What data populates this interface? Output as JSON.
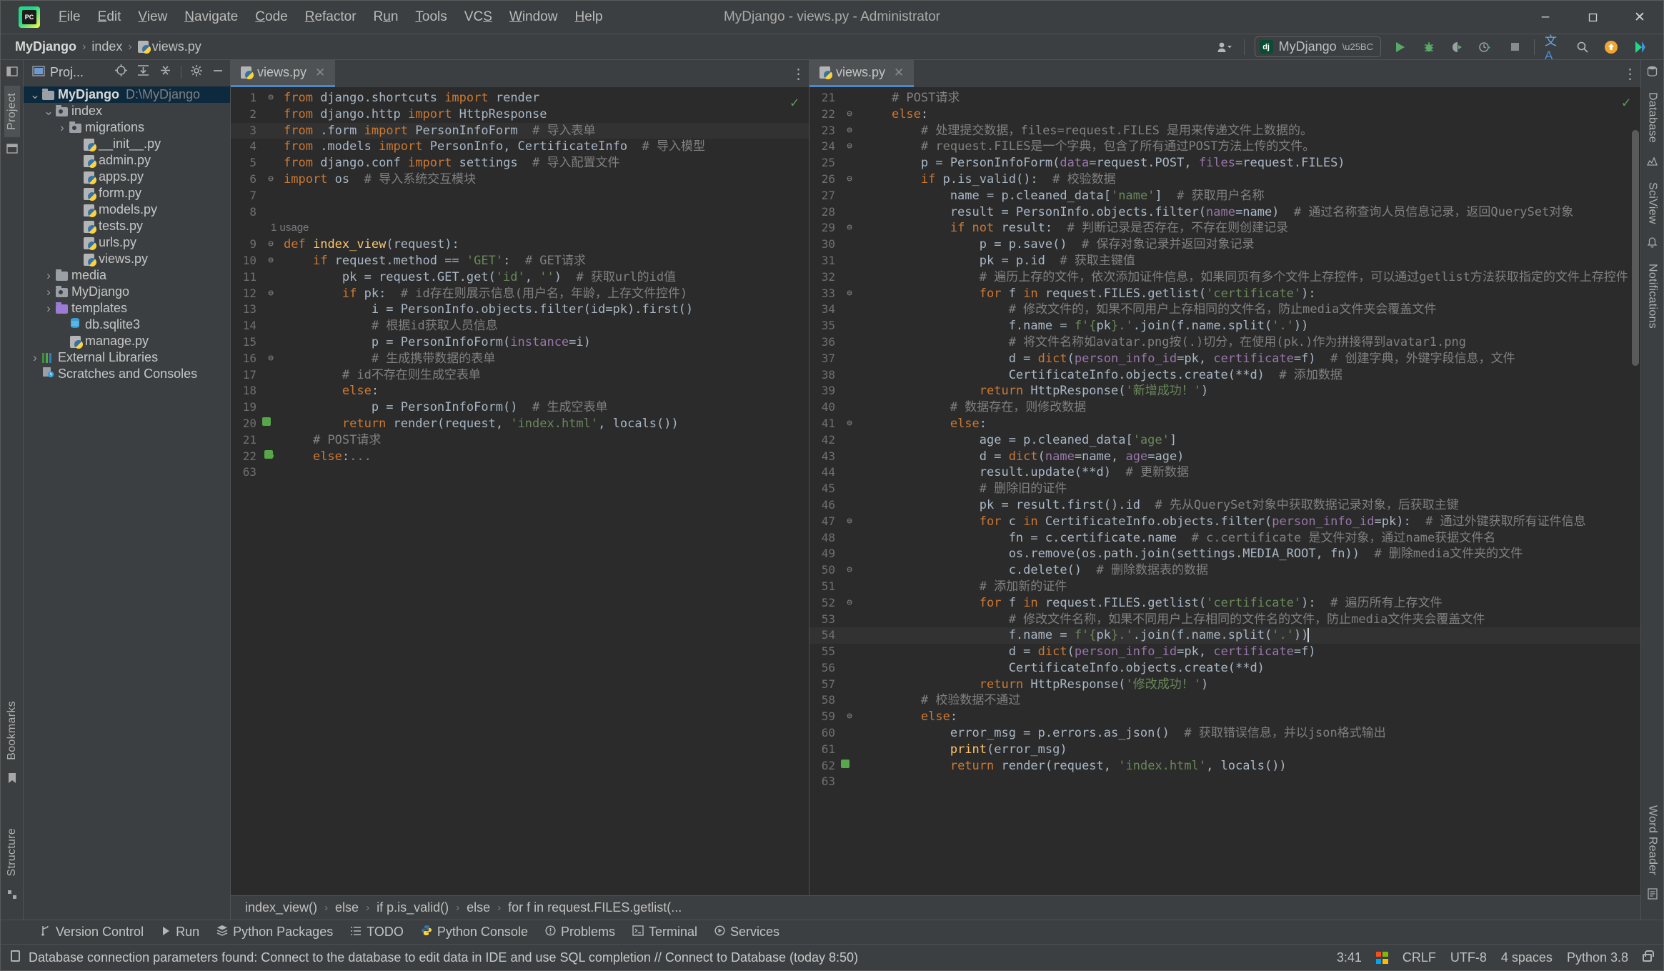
{
  "window": {
    "title": "MyDjango - views.py - Administrator",
    "app_icon": "pycharm-logo-icon",
    "controls": {
      "minimize": "–",
      "maximize": "☐",
      "close": "✕"
    }
  },
  "menubar": [
    {
      "label": "File",
      "mnemonic": "F"
    },
    {
      "label": "Edit",
      "mnemonic": "E"
    },
    {
      "label": "View",
      "mnemonic": "V"
    },
    {
      "label": "Navigate",
      "mnemonic": "N"
    },
    {
      "label": "Code",
      "mnemonic": "C"
    },
    {
      "label": "Refactor",
      "mnemonic": "R"
    },
    {
      "label": "Run",
      "mnemonic": "u"
    },
    {
      "label": "Tools",
      "mnemonic": "T"
    },
    {
      "label": "VCS",
      "mnemonic": "S"
    },
    {
      "label": "Window",
      "mnemonic": "W"
    },
    {
      "label": "Help",
      "mnemonic": "H"
    }
  ],
  "breadcrumb": {
    "project": "MyDjango",
    "folder": "index",
    "file": "views.py",
    "sep": "›"
  },
  "toolbar": {
    "run_config": "MyDjango",
    "run_config_badge": "dj",
    "icons": [
      {
        "name": "profile-icon",
        "glyph": "👤"
      },
      {
        "name": "run-icon",
        "glyph": "▶"
      },
      {
        "name": "debug-icon",
        "glyph": "🐞"
      },
      {
        "name": "run-coverage-icon",
        "glyph": "◐"
      },
      {
        "name": "profiler-icon",
        "glyph": "◴"
      },
      {
        "name": "stop-icon",
        "glyph": "■"
      },
      {
        "name": "translate-icon",
        "glyph": "文A"
      },
      {
        "name": "search-everywhere-icon",
        "glyph": "🔍"
      },
      {
        "name": "update-icon",
        "glyph": "↑"
      },
      {
        "name": "ide-feature-icon",
        "glyph": "◗"
      }
    ]
  },
  "left_strip": {
    "tabs": [
      {
        "label": "Project",
        "name": "tool-tab-project",
        "selected": true
      }
    ],
    "bottom_tabs": [
      {
        "label": "Bookmarks",
        "name": "tool-tab-bookmarks"
      },
      {
        "label": "Structure",
        "name": "tool-tab-structure"
      }
    ]
  },
  "right_strip": {
    "tabs": [
      {
        "label": "Database",
        "name": "tool-tab-database"
      },
      {
        "label": "SciView",
        "name": "tool-tab-sciview"
      },
      {
        "label": "Notifications",
        "name": "tool-tab-notifications"
      },
      {
        "label": "Word Reader",
        "name": "tool-tab-word-reader"
      }
    ]
  },
  "project_panel": {
    "title": "Proj...",
    "header_icons": [
      "locate-icon",
      "expand-all-icon",
      "collapse-all-icon",
      "settings-gear-icon",
      "hide-icon"
    ],
    "tree": [
      {
        "depth": 0,
        "arrow": "down",
        "icon": "folder",
        "label": "MyDjango",
        "path": "D:\\MyDjango",
        "bold": true,
        "selected": true
      },
      {
        "depth": 1,
        "arrow": "down",
        "icon": "folder-package",
        "label": "index"
      },
      {
        "depth": 2,
        "arrow": "right",
        "icon": "folder-package",
        "label": "migrations"
      },
      {
        "depth": 3,
        "arrow": "none",
        "icon": "python-file",
        "label": "__init__.py"
      },
      {
        "depth": 3,
        "arrow": "none",
        "icon": "python-file",
        "label": "admin.py"
      },
      {
        "depth": 3,
        "arrow": "none",
        "icon": "python-file",
        "label": "apps.py"
      },
      {
        "depth": 3,
        "arrow": "none",
        "icon": "python-file",
        "label": "form.py"
      },
      {
        "depth": 3,
        "arrow": "none",
        "icon": "python-file",
        "label": "models.py"
      },
      {
        "depth": 3,
        "arrow": "none",
        "icon": "python-file",
        "label": "tests.py"
      },
      {
        "depth": 3,
        "arrow": "none",
        "icon": "python-file",
        "label": "urls.py"
      },
      {
        "depth": 3,
        "arrow": "none",
        "icon": "python-file",
        "label": "views.py"
      },
      {
        "depth": 1,
        "arrow": "right",
        "icon": "folder",
        "label": "media"
      },
      {
        "depth": 1,
        "arrow": "right",
        "icon": "folder-package",
        "label": "MyDjango"
      },
      {
        "depth": 1,
        "arrow": "right",
        "icon": "folder-purple",
        "label": "templates"
      },
      {
        "depth": 2,
        "arrow": "none",
        "icon": "db-file",
        "label": "db.sqlite3"
      },
      {
        "depth": 2,
        "arrow": "none",
        "icon": "python-file",
        "label": "manage.py"
      },
      {
        "depth": 0,
        "arrow": "right",
        "icon": "library",
        "label": "External Libraries"
      },
      {
        "depth": 0,
        "arrow": "none",
        "icon": "scratches",
        "label": "Scratches and Consoles"
      }
    ]
  },
  "editor_left": {
    "tab": {
      "label": "views.py",
      "icon": "python-file",
      "close": "✕",
      "active": true
    },
    "inspection_ok": "✓",
    "lines": [
      {
        "n": "1",
        "fold": "⊖",
        "html": "<span class=\"kw\">from</span> django.shortcuts <span class=\"kw\">import</span> render"
      },
      {
        "n": "2",
        "fold": "",
        "html": "<span class=\"kw\">from</span> django.http <span class=\"kw\">import</span> HttpResponse"
      },
      {
        "n": "3",
        "fold": "",
        "hl": true,
        "html": "<span class=\"kw\">from</span> .form <span class=\"kw\">import</span> PersonInfoForm  <span class=\"cmt\"># 导入表单</span>"
      },
      {
        "n": "4",
        "fold": "",
        "html": "<span class=\"kw\">from</span> .models <span class=\"kw\">import</span> PersonInfo, CertificateInfo  <span class=\"cmt\"># 导入模型</span>"
      },
      {
        "n": "5",
        "fold": "",
        "html": "<span class=\"kw\">from</span> django.conf <span class=\"kw\">import</span> settings  <span class=\"cmt\"># 导入配置文件</span>"
      },
      {
        "n": "6",
        "fold": "⊖",
        "html": "<span class=\"kw\">import</span> os  <span class=\"cmt\"># 导入系统交互模块</span>"
      },
      {
        "n": "7",
        "fold": "",
        "html": ""
      },
      {
        "n": "8",
        "fold": "",
        "html": ""
      },
      {
        "n": "",
        "fold": "",
        "hint": "1 usage"
      },
      {
        "n": "9",
        "fold": "⊖",
        "html": "<span class=\"kw\">def</span> <span class=\"fn\">index_view</span>(request):"
      },
      {
        "n": "10",
        "fold": "⊖",
        "html": "    <span class=\"kw\">if</span> request.method == <span class=\"str\">'GET'</span>:  <span class=\"cmt\"># GET请求</span>"
      },
      {
        "n": "11",
        "fold": "",
        "html": "        pk = request.GET.get(<span class=\"str\">'id'</span>, <span class=\"str\">''</span>)  <span class=\"cmt\"># 获取url的id值</span>"
      },
      {
        "n": "12",
        "fold": "⊖",
        "html": "        <span class=\"kw\">if</span> pk:  <span class=\"cmt\"># id存在则展示信息(用户名，年龄，上存文件控件)</span>"
      },
      {
        "n": "13",
        "fold": "",
        "html": "            i = PersonInfo.objects.filter(id=pk).first()"
      },
      {
        "n": "14",
        "fold": "",
        "html": "            <span class=\"cmt\"># 根据id获取人员信息</span>"
      },
      {
        "n": "15",
        "fold": "",
        "html": "            p = PersonInfoForm(<span class=\"par\">instance</span>=i)"
      },
      {
        "n": "16",
        "fold": "⊖",
        "html": "            <span class=\"cmt\"># 生成携带数据的表单</span>"
      },
      {
        "n": "17",
        "fold": "",
        "html": "        <span class=\"cmt\"># id不存在则生成空表单</span>"
      },
      {
        "n": "18",
        "fold": "",
        "html": "        <span class=\"kw\">else</span>:"
      },
      {
        "n": "19",
        "fold": "",
        "html": "            p = PersonInfoForm()  <span class=\"cmt\"># 生成空表单</span>"
      },
      {
        "n": "20",
        "fold": "",
        "mark": true,
        "html": "        <span class=\"kw\">return</span> render(request, <span class=\"str\">'index.html'</span>, locals())"
      },
      {
        "n": "21",
        "fold": "",
        "html": "    <span class=\"cmt\"># POST请求</span>"
      },
      {
        "n": "22",
        "fold": "⊖",
        "mark": true,
        "html": "    <span class=\"kw\">else</span>:<span class=\"cmt\">...</span>"
      },
      {
        "n": "63",
        "fold": "",
        "html": ""
      }
    ]
  },
  "editor_right": {
    "tab": {
      "label": "views.py",
      "icon": "python-file",
      "close": "✕",
      "active": true
    },
    "inspection_ok": "✓",
    "lines": [
      {
        "n": "21",
        "fold": "",
        "html": "    <span class=\"cmt\"># POST请求</span>"
      },
      {
        "n": "22",
        "fold": "⊖",
        "html": "    <span class=\"kw\">else</span>:"
      },
      {
        "n": "23",
        "fold": "⊖",
        "html": "        <span class=\"cmt\"># 处理提交数据，files=request.FILES 是用来传递文件上数据的。</span>"
      },
      {
        "n": "24",
        "fold": "⊖",
        "html": "        <span class=\"cmt\"># request.FILES是一个字典，包含了所有通过POST方法上传的文件。</span>"
      },
      {
        "n": "25",
        "fold": "",
        "html": "        p = PersonInfoForm(<span class=\"par\">data</span>=request.POST, <span class=\"par\">files</span>=request.FILES)"
      },
      {
        "n": "26",
        "fold": "⊖",
        "html": "        <span class=\"kw\">if</span> p.is_valid():  <span class=\"cmt\"># 校验数据</span>"
      },
      {
        "n": "27",
        "fold": "",
        "html": "            name = p.cleaned_data[<span class=\"str\">'name'</span>]  <span class=\"cmt\"># 获取用户名称</span>"
      },
      {
        "n": "28",
        "fold": "",
        "html": "            result = PersonInfo.objects.filter(<span class=\"par\">name</span>=name)  <span class=\"cmt\"># 通过名称查询人员信息记录，返回QuerySet对象</span>"
      },
      {
        "n": "29",
        "fold": "⊖",
        "html": "            <span class=\"kw\">if not</span> result:  <span class=\"cmt\"># 判断记录是否存在，不存在则创建记录</span>"
      },
      {
        "n": "30",
        "fold": "",
        "html": "                p = p.save()  <span class=\"cmt\"># 保存对象记录并返回对象记录</span>"
      },
      {
        "n": "31",
        "fold": "",
        "html": "                pk = p.id  <span class=\"cmt\"># 获取主键值</span>"
      },
      {
        "n": "32",
        "fold": "",
        "html": "                <span class=\"cmt\"># 遍历上存的文件，依次添加证件信息，如果同页有多个文件上存控件，可以通过getlist方法获取指定的文件上存控件</span>"
      },
      {
        "n": "33",
        "fold": "⊖",
        "html": "                <span class=\"kw\">for</span> f <span class=\"kw\">in</span> request.FILES.getlist(<span class=\"str\">'certificate'</span>):"
      },
      {
        "n": "34",
        "fold": "",
        "html": "                    <span class=\"cmt\"># 修改文件的，如果不同用户上存相同的文件名，防止media文件夹会覆盖文件</span>"
      },
      {
        "n": "35",
        "fold": "",
        "html": "                    f.name = <span class=\"str\">f'{</span>pk<span class=\"str\">}.'</span>.join(f.name.split(<span class=\"str\">'.'</span>))"
      },
      {
        "n": "36",
        "fold": "",
        "html": "                    <span class=\"cmt\"># 将文件名称如avatar.png按(.)切分，在使用(pk.)作为拼接得到avatar1.png</span>"
      },
      {
        "n": "37",
        "fold": "",
        "html": "                    d = <span class=\"kw2\">dict</span>(<span class=\"par\">person_info_id</span>=pk, <span class=\"par\">certificate</span>=f)  <span class=\"cmt\"># 创建字典，外键字段信息，文件</span>"
      },
      {
        "n": "38",
        "fold": "",
        "html": "                    CertificateInfo.objects.create(**d)  <span class=\"cmt\"># 添加数据</span>"
      },
      {
        "n": "39",
        "fold": "",
        "html": "                <span class=\"kw\">return</span> HttpResponse(<span class=\"str\">'新增成功！'</span>)"
      },
      {
        "n": "40",
        "fold": "",
        "html": "            <span class=\"cmt\"># 数据存在，则修改数据</span>"
      },
      {
        "n": "41",
        "fold": "⊖",
        "html": "            <span class=\"kw\">else</span>:"
      },
      {
        "n": "42",
        "fold": "",
        "html": "                age = p.cleaned_data[<span class=\"str\">'age'</span>]"
      },
      {
        "n": "43",
        "fold": "",
        "html": "                d = <span class=\"kw2\">dict</span>(<span class=\"par\">name</span>=name, <span class=\"par\">age</span>=age)"
      },
      {
        "n": "44",
        "fold": "",
        "html": "                result.update(**d)  <span class=\"cmt\"># 更新数据</span>"
      },
      {
        "n": "45",
        "fold": "",
        "html": "                <span class=\"cmt\"># 删除旧的证件</span>"
      },
      {
        "n": "46",
        "fold": "",
        "html": "                pk = result.first().id  <span class=\"cmt\"># 先从QuerySet对象中获取数据记录对象，后获取主键</span>"
      },
      {
        "n": "47",
        "fold": "⊖",
        "html": "                <span class=\"kw\">for</span> c <span class=\"kw\">in</span> CertificateInfo.objects.filter(<span class=\"par\">person_info_id</span>=pk):  <span class=\"cmt\"># 通过外键获取所有证件信息</span>"
      },
      {
        "n": "48",
        "fold": "",
        "html": "                    fn = c.certificate.name  <span class=\"cmt\"># c.certificate 是文件对象，通过name获据文件名</span>"
      },
      {
        "n": "49",
        "fold": "",
        "html": "                    os.remove(os.path.join(settings.MEDIA_ROOT, fn))  <span class=\"cmt\"># 删除media文件夹的文件</span>"
      },
      {
        "n": "50",
        "fold": "⊖",
        "html": "                    c.delete()  <span class=\"cmt\"># 删除数据表的数据</span>"
      },
      {
        "n": "51",
        "fold": "",
        "html": "                <span class=\"cmt\"># 添加新的证件</span>"
      },
      {
        "n": "52",
        "fold": "⊖",
        "html": "                <span class=\"kw\">for</span> f <span class=\"kw\">in</span> request.FILES.getlist(<span class=\"str\">'certificate'</span>):  <span class=\"cmt\"># 遍历所有上存文件</span>"
      },
      {
        "n": "53",
        "fold": "",
        "html": "                    <span class=\"cmt\"># 修改文件名称，如果不同用户上存相同的文件名的文件，防止media文件夹会覆盖文件</span>"
      },
      {
        "n": "54",
        "fold": "",
        "hl": true,
        "caret": true,
        "html": "                    f.name = <span class=\"str\">f'{</span>pk<span class=\"str\">}.'</span>.join(f.name.split(<span class=\"str\">'.'</span>))"
      },
      {
        "n": "55",
        "fold": "",
        "html": "                    d = <span class=\"kw2\">dict</span>(<span class=\"par\">person_info_id</span>=pk, <span class=\"par\">certificate</span>=f)"
      },
      {
        "n": "56",
        "fold": "",
        "html": "                    CertificateInfo.objects.create(**d)"
      },
      {
        "n": "57",
        "fold": "",
        "html": "                <span class=\"kw\">return</span> HttpResponse(<span class=\"str\">'修改成功！'</span>)"
      },
      {
        "n": "58",
        "fold": "",
        "html": "        <span class=\"cmt\"># 校验数据不通过</span>"
      },
      {
        "n": "59",
        "fold": "⊖",
        "html": "        <span class=\"kw\">else</span>:"
      },
      {
        "n": "60",
        "fold": "",
        "html": "            error_msg = p.errors.as_json()  <span class=\"cmt\"># 获取错误信息，并以json格式输出</span>"
      },
      {
        "n": "61",
        "fold": "",
        "html": "            <span class=\"fn\">print</span>(error_msg)"
      },
      {
        "n": "62",
        "fold": "",
        "mark": true,
        "html": "            <span class=\"kw\">return</span> render(request, <span class=\"str\">'index.html'</span>, locals())"
      },
      {
        "n": "63",
        "fold": "",
        "html": ""
      }
    ]
  },
  "editor_breadcrumbs": [
    "index_view()",
    "else",
    "if p.is_valid()",
    "else",
    "for f in request.FILES.getlist(..."
  ],
  "bottom_tools": [
    {
      "label": "Version Control",
      "icon": "branch-icon"
    },
    {
      "label": "Run",
      "icon": "run-icon"
    },
    {
      "label": "Python Packages",
      "icon": "packages-icon"
    },
    {
      "label": "TODO",
      "icon": "todo-icon"
    },
    {
      "label": "Python Console",
      "icon": "python-console-icon"
    },
    {
      "label": "Problems",
      "icon": "problems-icon"
    },
    {
      "label": "Terminal",
      "icon": "terminal-icon"
    },
    {
      "label": "Services",
      "icon": "services-icon"
    }
  ],
  "statusbar": {
    "icon": "notification-icon",
    "message": "Database connection parameters found: Connect to the database to edit data in IDE and use SQL completion // Connect to Database (today 8:50)",
    "caret": "3:41",
    "os_icon": "windows-icon",
    "line_separator": "CRLF",
    "encoding": "UTF-8",
    "indent": "4 spaces",
    "interpreter": "Python 3.8",
    "lock": "lock-icon"
  }
}
